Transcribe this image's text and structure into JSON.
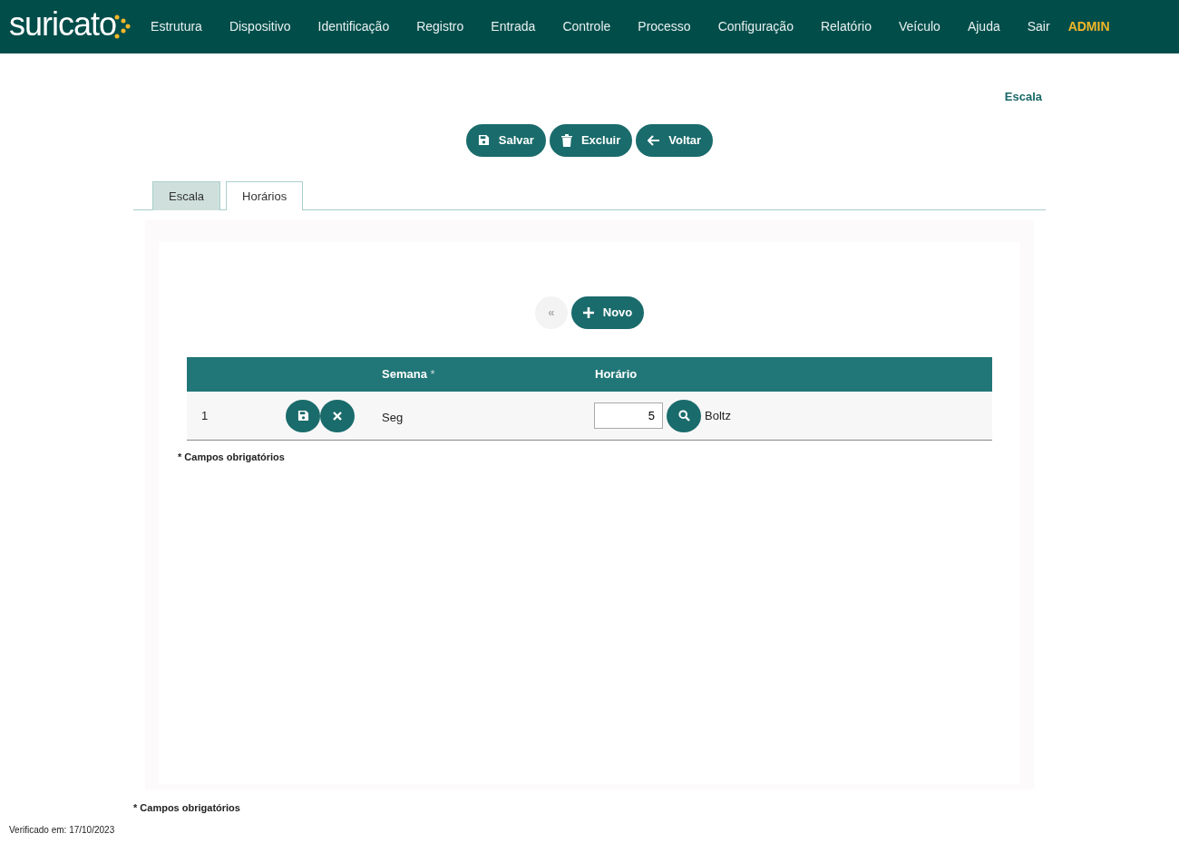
{
  "navbar": {
    "logo": "suricato",
    "items": [
      "Estrutura",
      "Dispositivo",
      "Identificação",
      "Registro",
      "Entrada",
      "Controle",
      "Processo",
      "Configuração",
      "Relatório",
      "Veículo",
      "Ajuda",
      "Sair"
    ],
    "user": "ADMIN"
  },
  "page_title": "Escala",
  "actions": [
    {
      "kind": "save",
      "label": "Salvar"
    },
    {
      "kind": "delete",
      "label": "Excluir"
    },
    {
      "kind": "back",
      "label": "Voltar"
    }
  ],
  "tabs": [
    {
      "label": "Escala",
      "selected": false
    },
    {
      "label": "Horários",
      "selected": true
    }
  ],
  "panel": {
    "first_button": {
      "label": "«",
      "disabled": true
    },
    "new_button": {
      "label": "Novo"
    },
    "table": {
      "columns": [
        {},
        {},
        {
          "label": "Semana",
          "marker": "*"
        },
        {
          "label": "Horário"
        }
      ],
      "rows": [
        {
          "index": "1",
          "semana": "Seg",
          "horario_value": "5",
          "horario_name": "Boltz"
        }
      ]
    },
    "note": "* Campos obrigatórios"
  },
  "footer_note": "* Campos obrigatórios",
  "verified": "Verificado em: 17/10/2023"
}
